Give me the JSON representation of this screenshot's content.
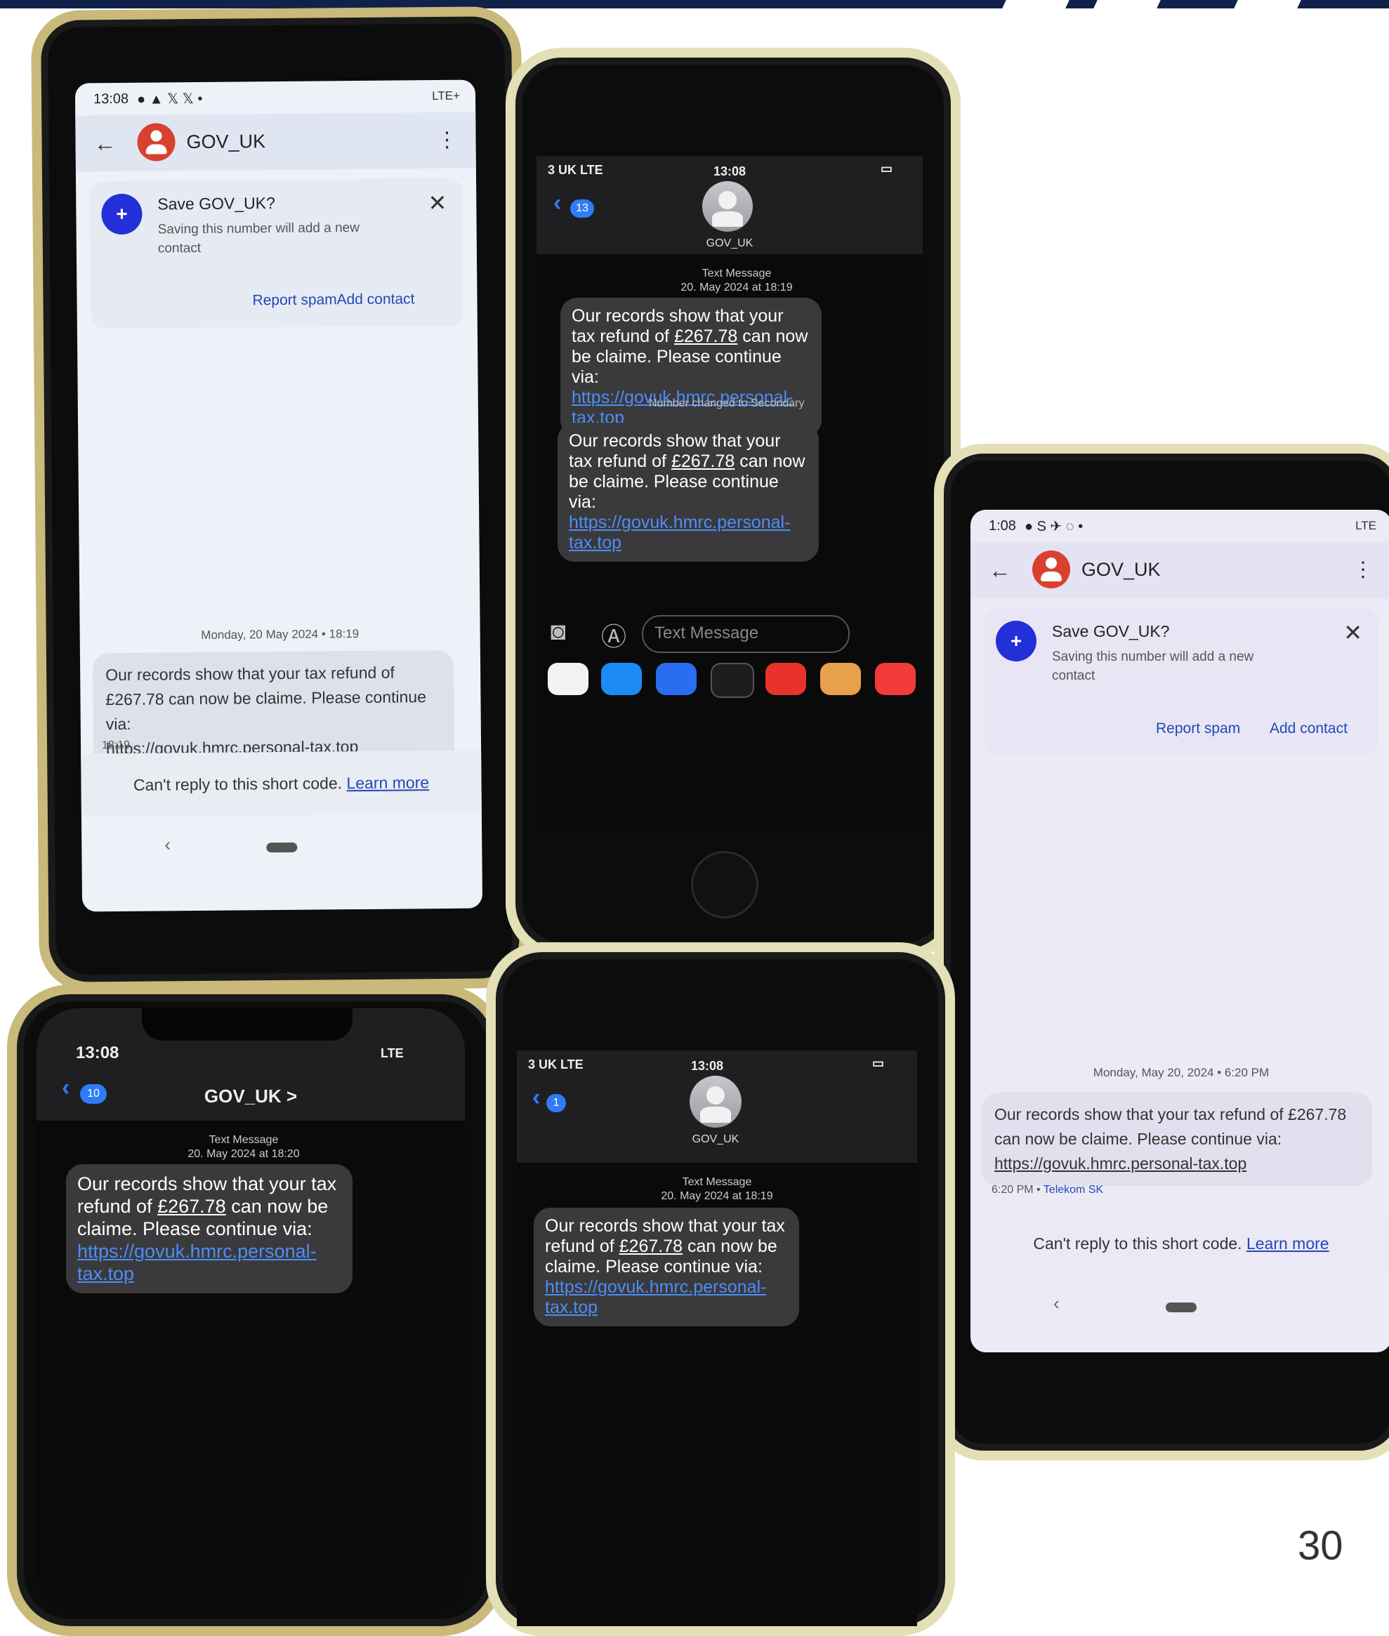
{
  "page_number": "30",
  "phones": {
    "a": {
      "status_time": "13:08",
      "status_right": "LTE+",
      "title": "GOV_UK",
      "save_title": "Save GOV_UK?",
      "save_sub": "Saving this number will add a new contact",
      "report_spam": "Report spam",
      "add_contact": "Add contact",
      "date": "Monday, 20 May 2024 • 18:19",
      "message_text": "Our records show that your tax refund of £267.78 can now be claime. Please continue via:",
      "message_link": "https://govuk.hmrc.personal-tax.top",
      "message_time": "18:19",
      "cant_reply": "Can't reply to this short code.",
      "learn_more": "Learn more"
    },
    "b": {
      "carrier": "3 UK  LTE",
      "time": "13:08",
      "back_count": "13",
      "contact_name": "GOV_UK",
      "meta_line1": "Text Message",
      "meta_line2": "20. May 2024 at 18:19",
      "msg1_before": "Our records show that your tax refund of",
      "amount": "£267.78",
      "msg1_after": "can now be claime. Please continue via:",
      "link": "https://govuk.hmrc.personal-tax.top",
      "note": "Number changed to Secondary",
      "input_placeholder": "Text Message"
    },
    "c": {
      "status_time": "1:08",
      "status_right": "LTE",
      "title": "GOV_UK",
      "save_title": "Save GOV_UK?",
      "save_sub": "Saving this number will add a new contact",
      "report_spam": "Report spam",
      "add_contact": "Add contact",
      "date": "Monday, May 20, 2024 • 6:20 PM",
      "message_text": "Our records show that your tax refund of £267.78 can now be claime. Please continue via:",
      "message_link": "https://govuk.hmrc.personal-tax.top",
      "message_time": "6:20 PM •",
      "carrier": "Telekom SK",
      "cant_reply": "Can't reply to this short code.",
      "learn_more": "Learn more"
    },
    "d": {
      "time": "13:08",
      "network": "LTE",
      "back_count": "10",
      "contact_name": "GOV_UK >",
      "meta_line1": "Text Message",
      "meta_line2": "20. May 2024 at 18:20",
      "msg_before": "Our records show that your tax refund of",
      "amount": "£267.78",
      "msg_after": "can now be claime. Please continue via:",
      "link": "https://govuk.hmrc.personal-tax.top"
    },
    "e": {
      "carrier": "3 UK  LTE",
      "time": "13:08",
      "back_count": "1",
      "contact_name": "GOV_UK",
      "meta_line1": "Text Message",
      "meta_line2": "20. May 2024 at 18:19",
      "msg_before": "Our records show that your tax refund of",
      "amount": "£267.78",
      "msg_after": "can now be claime. Please continue via:",
      "link": "https://govuk.hmrc.personal-tax.top"
    }
  },
  "colors": {
    "topbar": "#11224a",
    "ios_link": "#4d8df7",
    "android_link": "#2247b8",
    "avatar_red": "#d9412f"
  }
}
